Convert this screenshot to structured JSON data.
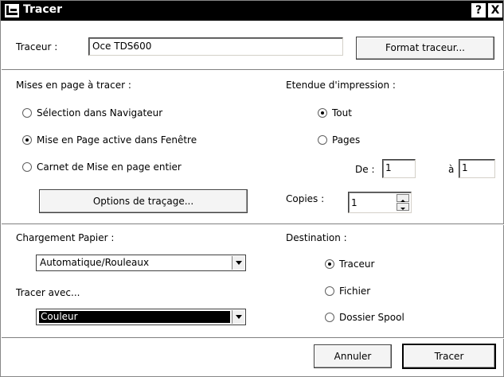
{
  "window": {
    "title": "Tracer",
    "help_label": "?",
    "close_label": "X"
  },
  "plotter": {
    "label": "Traceur :",
    "value": "Oce TDS600",
    "format_button": "Format traceur..."
  },
  "layouts": {
    "heading": "Mises en page à tracer :",
    "options": [
      {
        "label": "Sélection dans Navigateur",
        "selected": false
      },
      {
        "label": "Mise en Page active dans Fenêtre",
        "selected": true
      },
      {
        "label": "Carnet de Mise en page entier",
        "selected": false
      }
    ],
    "options_button": "Options de traçage..."
  },
  "range": {
    "heading": "Etendue d'impression :",
    "options": [
      {
        "label": "Tout",
        "selected": true
      },
      {
        "label": "Pages",
        "selected": false
      }
    ],
    "from_label": "De :",
    "from_value": "1",
    "to_label": "à",
    "to_value": "1"
  },
  "copies": {
    "label": "Copies :",
    "value": "1"
  },
  "paper": {
    "label": "Chargement Papier :",
    "selected": "Automatique/Rouleaux"
  },
  "plot_with": {
    "label": "Tracer avec...",
    "selected": "Couleur"
  },
  "destination": {
    "heading": "Destination :",
    "options": [
      {
        "label": "Traceur",
        "selected": true
      },
      {
        "label": "Fichier",
        "selected": false
      },
      {
        "label": "Dossier Spool",
        "selected": false
      }
    ]
  },
  "footer": {
    "cancel_label": "Annuler",
    "plot_label": "Tracer"
  }
}
